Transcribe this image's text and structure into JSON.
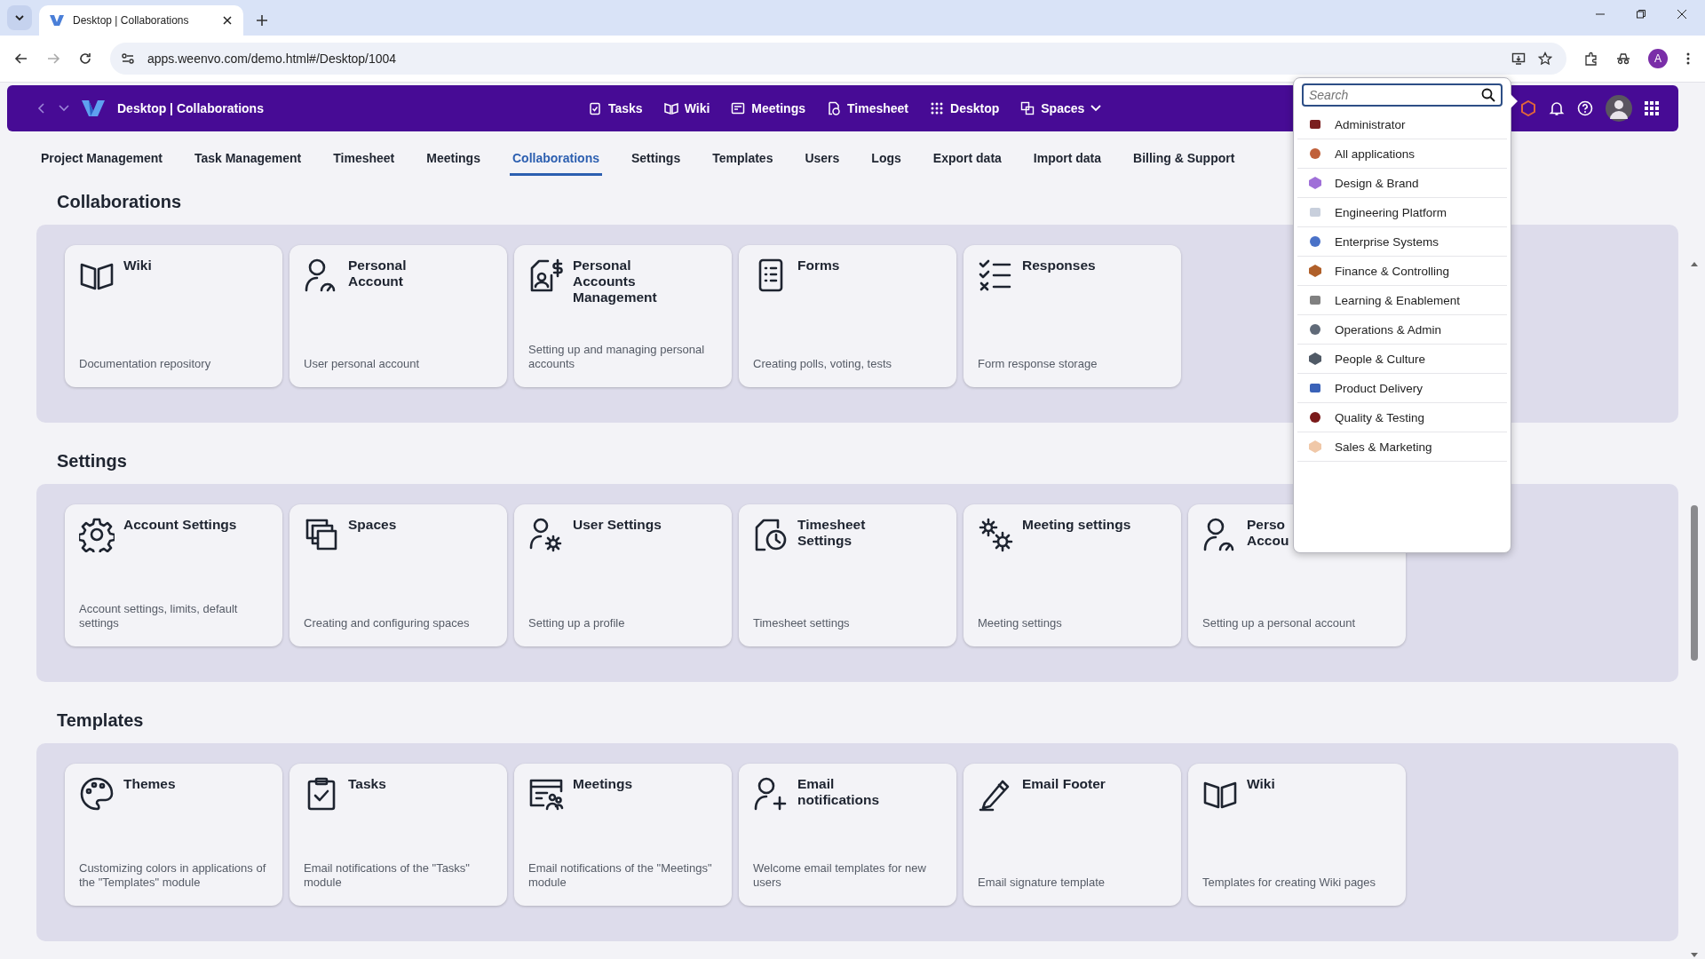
{
  "browser": {
    "tab_title": "Desktop | Collaborations",
    "url": "apps.weenvo.com/demo.html#/Desktop/1004",
    "profile_initial": "A"
  },
  "header": {
    "title": "Desktop | Collaborations",
    "nav": [
      {
        "label": "Tasks"
      },
      {
        "label": "Wiki"
      },
      {
        "label": "Meetings"
      },
      {
        "label": "Timesheet"
      },
      {
        "label": "Desktop"
      },
      {
        "label": "Spaces",
        "dropdown": true
      }
    ]
  },
  "tabs": [
    {
      "label": "Project Management",
      "selected": false
    },
    {
      "label": "Task Management",
      "selected": false
    },
    {
      "label": "Timesheet",
      "selected": false
    },
    {
      "label": "Meetings",
      "selected": false
    },
    {
      "label": "Collaborations",
      "selected": true
    },
    {
      "label": "Settings",
      "selected": false
    },
    {
      "label": "Templates",
      "selected": false
    },
    {
      "label": "Users",
      "selected": false
    },
    {
      "label": "Logs",
      "selected": false
    },
    {
      "label": "Export data",
      "selected": false
    },
    {
      "label": "Import data",
      "selected": false
    },
    {
      "label": "Billing & Support",
      "selected": false
    }
  ],
  "sections": [
    {
      "title": "Collaborations",
      "cards": [
        {
          "title": "Wiki",
          "description": "Documentation repository"
        },
        {
          "title": "Personal\nAccount",
          "description": "User personal account"
        },
        {
          "title": "Personal\nAccounts\nManagement",
          "description": "Setting up and managing personal accounts"
        },
        {
          "title": "Forms",
          "description": "Creating polls, voting, tests"
        },
        {
          "title": "Responses",
          "description": "Form response storage"
        }
      ]
    },
    {
      "title": "Settings",
      "cards": [
        {
          "title": "Account Settings",
          "description": "Account settings, limits, default settings"
        },
        {
          "title": "Spaces",
          "description": "Creating and configuring spaces"
        },
        {
          "title": "User Settings",
          "description": "Setting up a profile"
        },
        {
          "title": "Timesheet\nSettings",
          "description": "Timesheet settings"
        },
        {
          "title": "Meeting settings",
          "description": "Meeting settings"
        },
        {
          "title": "Perso\nAccou",
          "description": "Setting up a personal account"
        }
      ]
    },
    {
      "title": "Templates",
      "cards": [
        {
          "title": "Themes",
          "description": "Customizing colors in applications of the \"Templates\" module"
        },
        {
          "title": "Tasks",
          "description": "Email notifications of the \"Tasks\" module"
        },
        {
          "title": "Meetings",
          "description": "Email notifications of the \"Meetings\" module"
        },
        {
          "title": "Email\nnotifications",
          "description": "Welcome email templates for new users"
        },
        {
          "title": "Email Footer",
          "description": "Email signature template"
        },
        {
          "title": "Wiki",
          "description": "Templates for creating Wiki pages"
        }
      ]
    }
  ],
  "app_menu": {
    "search": {
      "placeholder": "Search"
    },
    "items": [
      {
        "label": "Administrator",
        "color": "#7a1f1f"
      },
      {
        "label": "All applications",
        "color": "#c0603a"
      },
      {
        "label": "Design & Brand",
        "color": "#a070d8"
      },
      {
        "label": "Engineering Platform",
        "color": "#c8cfdc"
      },
      {
        "label": "Enterprise Systems",
        "color": "#4a72c8"
      },
      {
        "label": "Finance & Controlling",
        "color": "#b0602a"
      },
      {
        "label": "Learning & Enablement",
        "color": "#808080"
      },
      {
        "label": "Operations & Admin",
        "color": "#606a78"
      },
      {
        "label": "People & Culture",
        "color": "#505a66"
      },
      {
        "label": "Product Delivery",
        "color": "#3a62b8"
      },
      {
        "label": "Quality & Testing",
        "color": "#7a1a1a"
      },
      {
        "label": "Sales & Marketing",
        "color": "#f0c8a8"
      }
    ]
  }
}
